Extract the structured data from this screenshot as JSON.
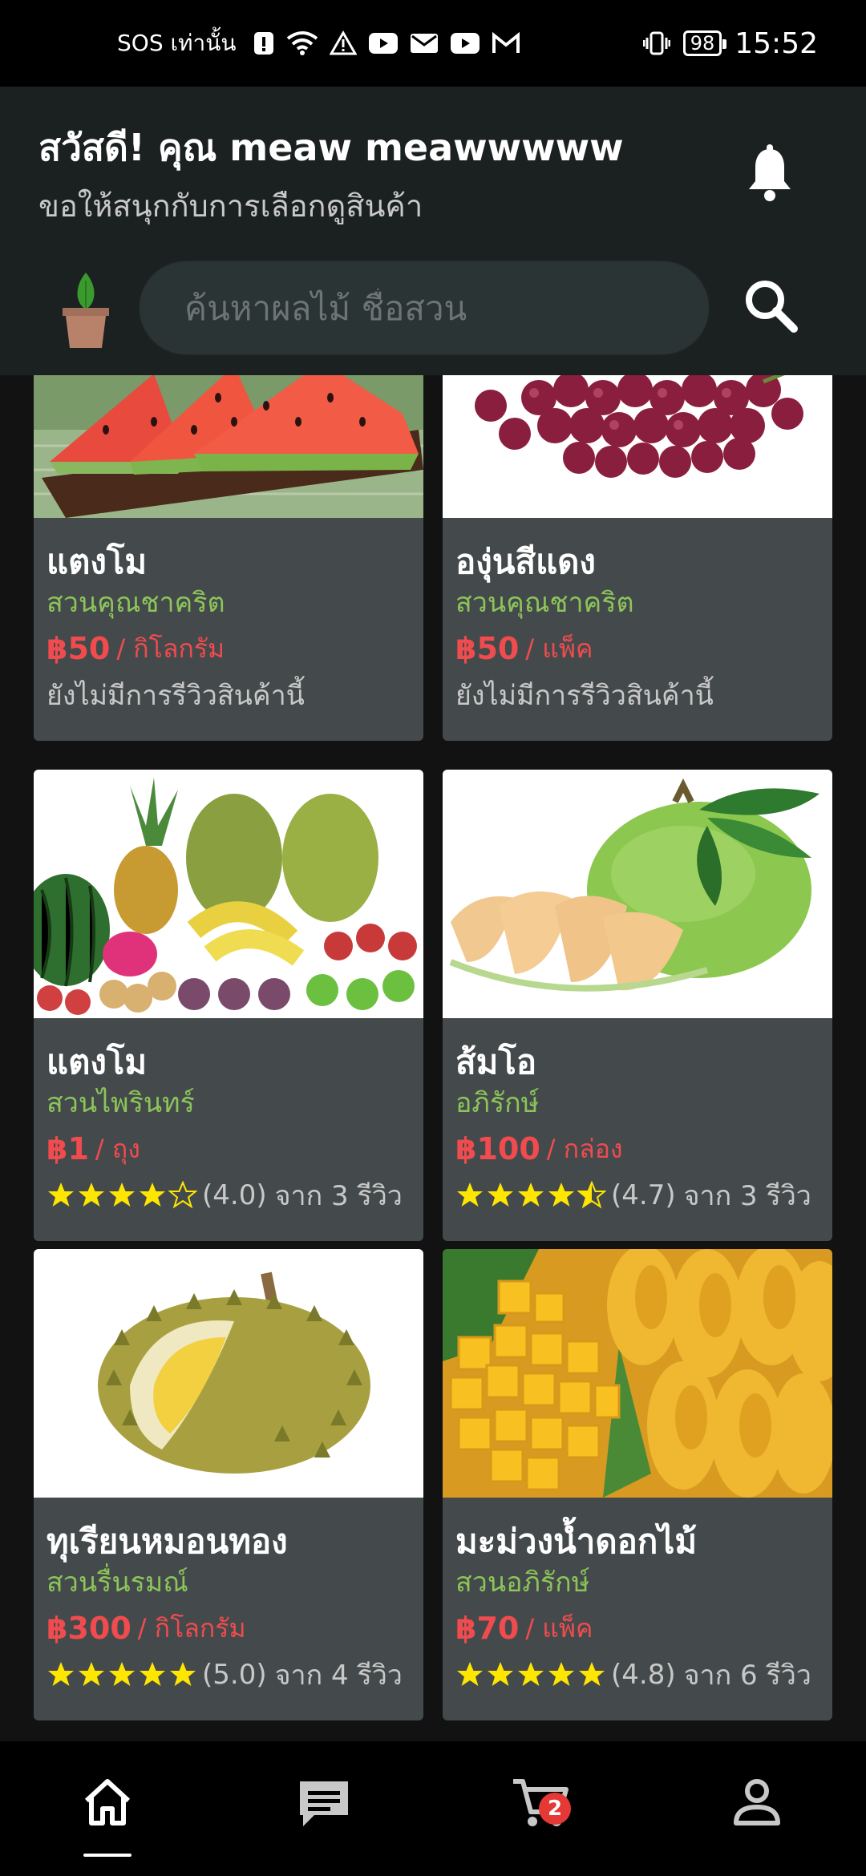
{
  "status_bar": {
    "carrier": "SOS เท่านั้น",
    "battery": "98",
    "time": "15:52"
  },
  "header": {
    "greeting": "สวัสดี! คุณ meaw meawwwww",
    "subgreeting": "ขอให้สนุกกับการเลือกดูสินค้า",
    "search_placeholder": "ค้นหาผลไม้ ชื่อสวน"
  },
  "products": [
    {
      "name": "แตงโม",
      "farm": "สวนคุณชาคริต",
      "price": "฿50",
      "unit": "/ กิโลกรัม",
      "review_text": "ยังไม่มีการรีวิวสินค้านี้",
      "image": "watermelon-slices"
    },
    {
      "name": "องุ่นสีแดง",
      "farm": "สวนคุณชาคริต",
      "price": "฿50",
      "unit": "/ แพ็ค",
      "review_text": "ยังไม่มีการรีวิวสินค้านี้",
      "image": "red-grapes"
    },
    {
      "name": "แตงโม",
      "farm": "สวนไพรินทร์",
      "price": "฿1",
      "unit": "/ ถุง",
      "rating": 4.0,
      "rating_label": "(4.0)",
      "reviews_label": "จาก 3 รีวิว",
      "image": "mixed-fruits"
    },
    {
      "name": "ส้มโอ",
      "farm": "อภิรักษ์",
      "price": "฿100",
      "unit": "/ กล่อง",
      "rating": 4.7,
      "rating_label": "(4.7)",
      "reviews_label": "จาก 3 รีวิว",
      "image": "pomelo"
    },
    {
      "name": "ทุเรียนหมอนทอง",
      "farm": "สวนรื่นรมณ์",
      "price": "฿300",
      "unit": "/ กิโลกรัม",
      "rating": 5.0,
      "rating_label": "(5.0)",
      "reviews_label": "จาก 4 รีวิว",
      "image": "durian"
    },
    {
      "name": "มะม่วงน้ำดอกไม้",
      "farm": "สวนอภิรักษ์",
      "price": "฿70",
      "unit": "/ แพ็ค",
      "rating": 4.8,
      "rating_label": "(4.8)",
      "reviews_label": "จาก 6 รีวิว",
      "image": "mango"
    }
  ],
  "bottom_nav": {
    "items": [
      "home-icon",
      "chat-icon",
      "cart-icon",
      "profile-icon"
    ],
    "active": "home-icon",
    "cart_badge": "2"
  },
  "colors": {
    "header_bg": "#1b2021",
    "card_bg": "#444a4b",
    "price": "#f04b4e",
    "farm": "#8cc45a",
    "star": "#ffe600"
  }
}
